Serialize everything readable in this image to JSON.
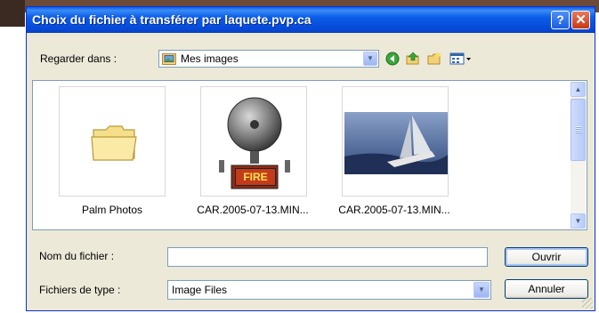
{
  "window": {
    "title": "Choix du fichier à transférer par laquete.pvp.ca"
  },
  "toolbar": {
    "look_in_label": "Regarder dans :",
    "look_in_value": "Mes images",
    "help_glyph": "?",
    "close_glyph": "✕",
    "icons": [
      "back-icon",
      "up-folder-icon",
      "new-folder-icon",
      "view-menu-icon"
    ]
  },
  "files": [
    {
      "name": "Palm Photos",
      "kind": "folder"
    },
    {
      "name": "CAR.2005-07-13.MIN...",
      "kind": "image",
      "badge": "FIRE"
    },
    {
      "name": "CAR.2005-07-13.MIN...",
      "kind": "image"
    }
  ],
  "form": {
    "filename_label": "Nom du fichier :",
    "filename_value": "",
    "filetype_label": "Fichiers de type :",
    "filetype_value": "Image Files"
  },
  "buttons": {
    "open": "Ouvrir",
    "cancel": "Annuler"
  },
  "colors": {
    "title_blue": "#0a5ce8",
    "dialog_bg": "#ece9d8",
    "close_red": "#c83a15"
  }
}
